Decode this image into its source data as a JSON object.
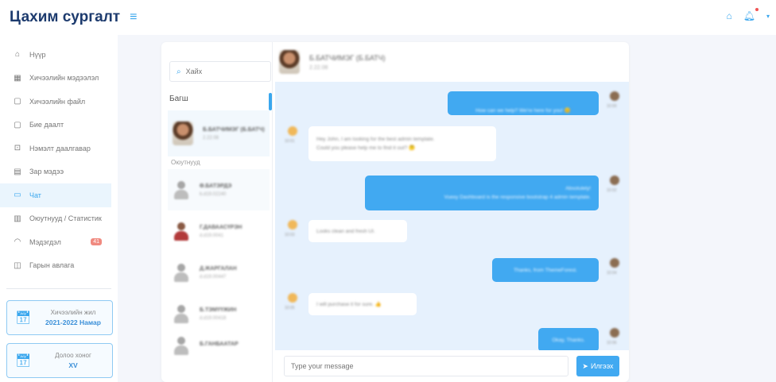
{
  "app": {
    "brand": "Цахим сургалт",
    "menu_icon": "hamburger-icon",
    "top_icons": [
      "home-icon",
      "bell-icon",
      "chevron-down-icon"
    ]
  },
  "sidebar": {
    "items": [
      {
        "label": "Нүүр",
        "icon": "home-icon",
        "active": false
      },
      {
        "label": "Хичээлийн мэдээлэл",
        "icon": "table-icon",
        "active": false
      },
      {
        "label": "Хичээлийн файл",
        "icon": "file-icon",
        "active": false
      },
      {
        "label": "Бие даалт",
        "icon": "document-icon",
        "active": false
      },
      {
        "label": "Нэмэлт даалгавар",
        "icon": "task-icon",
        "active": false
      },
      {
        "label": "Зар мэдээ",
        "icon": "news-icon",
        "active": false
      },
      {
        "label": "Чат",
        "icon": "chat-icon",
        "active": true
      },
      {
        "label": "Оюутнууд / Статистик",
        "icon": "bar-chart-icon",
        "active": false
      },
      {
        "label": "Мэдэгдэл",
        "icon": "bell-icon",
        "active": false,
        "badge": "41"
      },
      {
        "label": "Гарын авлага",
        "icon": "book-icon",
        "active": false
      }
    ],
    "cards": [
      {
        "label": "Хичээлийн жил",
        "value": "2021-2022 Намар",
        "icon": "calendar-icon"
      },
      {
        "label": "Долоо хоног",
        "value": "XV",
        "icon": "calendar-icon"
      }
    ]
  },
  "chat": {
    "search_placeholder": "Хайх",
    "section_teacher": "Багш",
    "section_students": "Оюутнууд",
    "teacher": {
      "name": "Б.БАТЧИМЭГ (Б.БАТЧ)",
      "sub": "2.22.08"
    },
    "contacts": [
      {
        "name": "Ө.БАТЭРДЭ",
        "sub": "b.d19.02240",
        "avatar": "gray"
      },
      {
        "name": "Г.ДАВААСҮРЭН",
        "sub": "d.d19.0041",
        "avatar": "red"
      },
      {
        "name": "Д.ЖАРГАЛАН",
        "sub": "d.d19.00447",
        "avatar": "gray"
      },
      {
        "name": "Б.ТЭМҮҮЖИН",
        "sub": "d.d19.00418",
        "avatar": "gray"
      },
      {
        "name": "Б.ГАНБААТАР",
        "sub": "",
        "avatar": "gray"
      }
    ],
    "header": {
      "name": "Б.БАТЧИМЭГ (Б.БАТЧ)",
      "sub": "2.22.08"
    },
    "messages": [
      {
        "dir": "out",
        "lines": [
          "How can we help? We're here for you! 😊"
        ],
        "time": "10:00"
      },
      {
        "dir": "in",
        "lines": [
          "Hey John, I am looking for the best admin template.",
          "Could you please help me to find it out? 🤔"
        ],
        "time": "10:01"
      },
      {
        "dir": "out",
        "lines": [
          "Absolutely!",
          "Vuexy Dashboard is the responsive bootstrap 4 admin template."
        ],
        "time": "10:02"
      },
      {
        "dir": "in",
        "lines": [
          "Looks clean and fresh UI."
        ],
        "time": "10:03"
      },
      {
        "dir": "out",
        "lines": [
          "Thanks, from ThemeForest."
        ],
        "time": "10:04"
      },
      {
        "dir": "in",
        "lines": [
          "I will purchase it for sure. 👍"
        ],
        "time": "10:05"
      },
      {
        "dir": "out",
        "lines": [
          "Okay, Thanks."
        ],
        "time": "10:06"
      }
    ],
    "composer_placeholder": "Type your message",
    "send_label": "Илгээх",
    "send_icon": "send-icon"
  }
}
